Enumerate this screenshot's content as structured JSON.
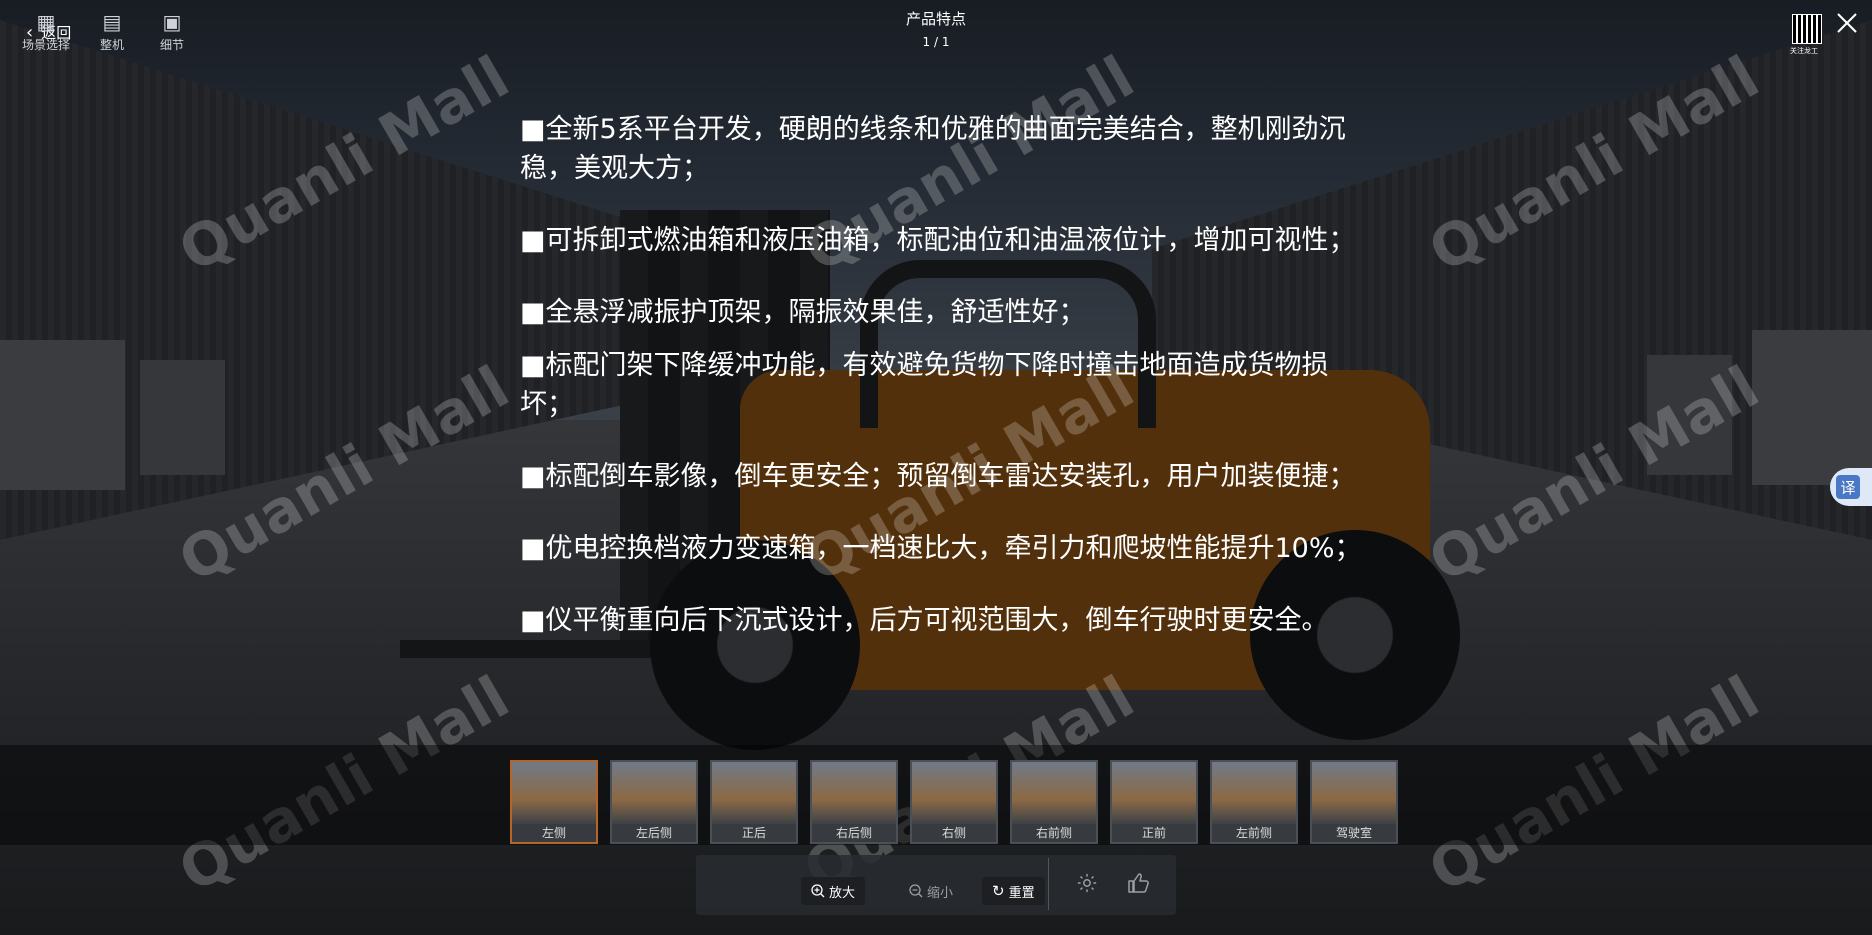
{
  "header": {
    "back_label": "返回",
    "title": "产品特点",
    "page_indicator": "1 / 1",
    "qr_label": "关注龙工"
  },
  "features": [
    "■全新5系平台开发，硬朗的线条和优雅的曲面完美结合，整机刚劲沉稳，美观大方；",
    "■可拆卸式燃油箱和液压油箱，标配油位和油温液位计，增加可视性；",
    "■全悬浮减振护顶架，隔振效果佳，舒适性好；",
    "■标配门架下降缓冲功能，有效避免货物下降时撞击地面造成货物损坏；",
    "■标配倒车影像，倒车更安全；预留倒车雷达安装孔，用户加装便捷；",
    "■优电控换档液力变速箱，一档速比大，牵引力和爬坡性能提升10%；",
    "■仪平衡重向后下沉式设计，后方可视范围大，倒车行驶时更安全。"
  ],
  "watermark": "Quanli Mall",
  "translate_label": "译",
  "thumbnails": [
    {
      "label": "左侧",
      "active": true
    },
    {
      "label": "左后侧",
      "active": false
    },
    {
      "label": "正后",
      "active": false
    },
    {
      "label": "右后侧",
      "active": false
    },
    {
      "label": "右侧",
      "active": false
    },
    {
      "label": "右前侧",
      "active": false
    },
    {
      "label": "正前",
      "active": false
    },
    {
      "label": "左前侧",
      "active": false
    },
    {
      "label": "驾驶室",
      "active": false
    }
  ],
  "toolbar": {
    "scene_select": "场景选择",
    "tool2": "整机",
    "tool3": "细节",
    "zoom_in": "放大",
    "zoom_out": "缩小",
    "reset": "重置"
  }
}
